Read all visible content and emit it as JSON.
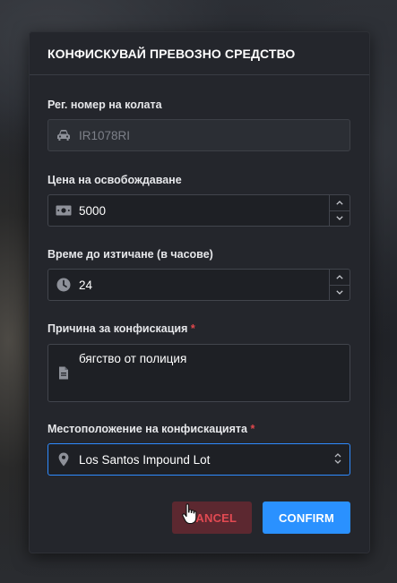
{
  "modal": {
    "title": "КОНФИСКУВАЙ ПРЕВОЗНО СРЕДСТВО"
  },
  "fields": {
    "plate": {
      "label": "Рег. номер на колата",
      "value": "IR1078RI",
      "icon": "car-icon",
      "disabled": true
    },
    "price": {
      "label": "Цена на освобождаване",
      "value": "5000",
      "icon": "money-icon"
    },
    "expiry": {
      "label": "Време до изтичане (в часове)",
      "value": "24",
      "icon": "clock-icon"
    },
    "reason": {
      "label": "Причина за конфискация",
      "required_mark": "*",
      "value": "бягство от полиция",
      "icon": "document-icon"
    },
    "location": {
      "label": "Местоположение на конфискацията",
      "required_mark": "*",
      "value": "Los Santos Impound Lot",
      "icon": "map-pin-icon"
    }
  },
  "buttons": {
    "cancel": "CANCEL",
    "confirm": "CONFIRM"
  },
  "colors": {
    "accent": "#2a91ff",
    "danger": "#e24a52",
    "required": "#e0474c",
    "modal_bg": "#24262c"
  }
}
